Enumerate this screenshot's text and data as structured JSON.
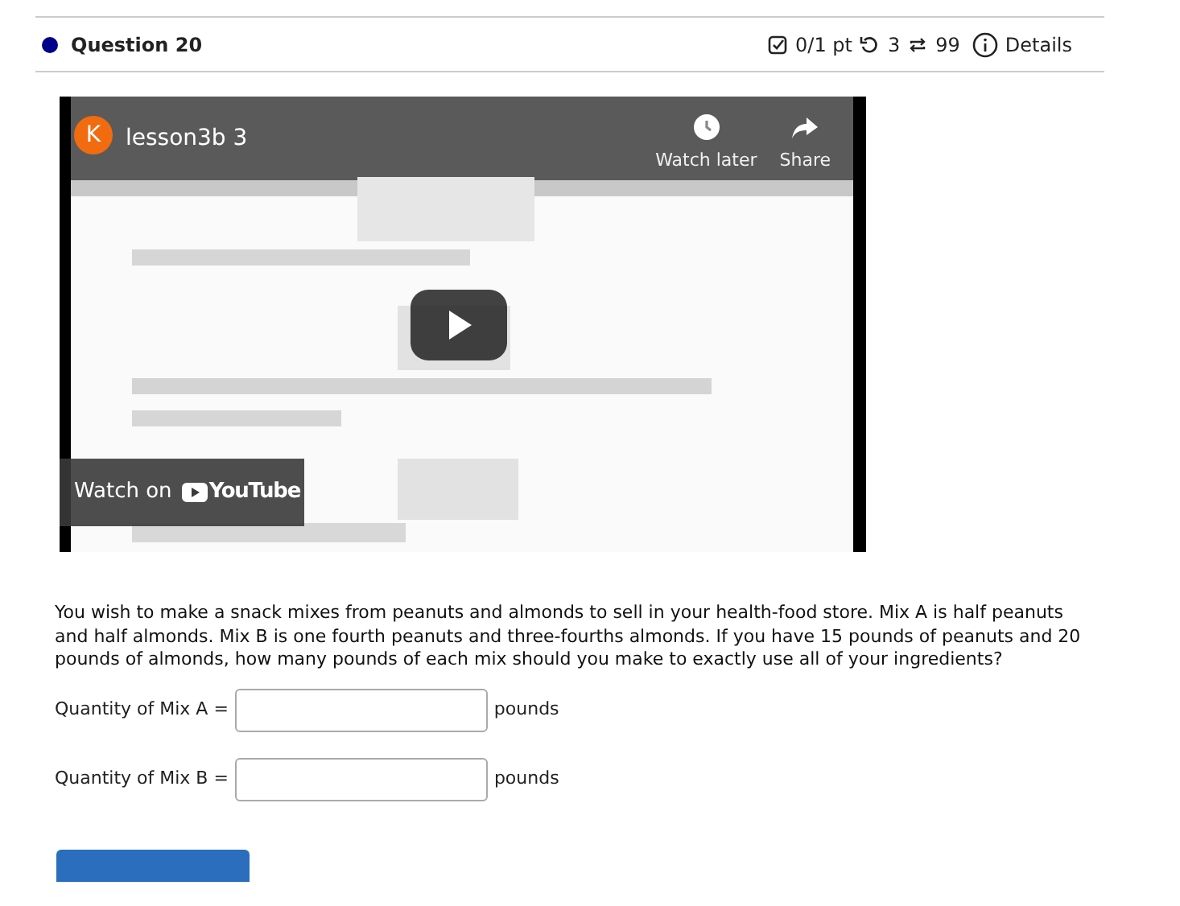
{
  "question": {
    "title": "Question 20",
    "score": "0/1 pt",
    "retries": "3",
    "attempts": "99",
    "details": "Details"
  },
  "video": {
    "kind": "picture",
    "channel_initial": "K",
    "title": "lesson3b 3",
    "watch_later": "Watch later",
    "share": "Share",
    "watch_on": "Watch on",
    "youtube": "YouTube"
  },
  "prompt": "You wish to make a snack mixes from peanuts and almonds to sell in your health-food store. Mix A is half peanuts and half almonds. Mix B is one fourth peanuts and three-fourths almonds. If you have 15 pounds of peanuts and 20 pounds of almonds, how many pounds of each mix should you make to exactly use all of your ingredients?",
  "answers": [
    {
      "label": "Quantity of Mix A =",
      "unit": "pounds"
    },
    {
      "label": "Quantity of Mix B =",
      "unit": "pounds"
    }
  ],
  "submit": {
    "kind": "button"
  }
}
